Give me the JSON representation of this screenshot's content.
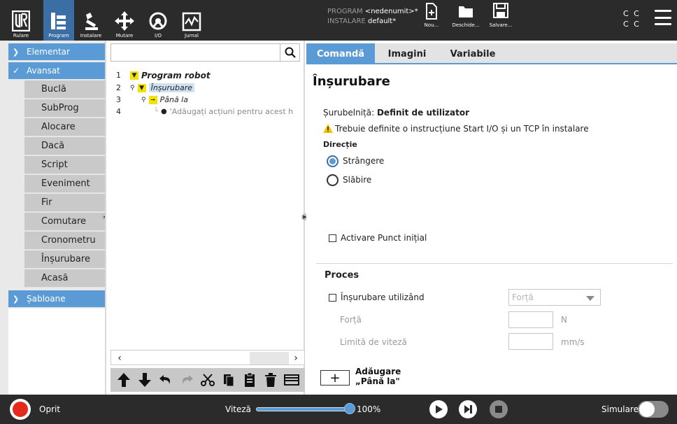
{
  "header": {
    "nav": [
      {
        "label": "Rulare",
        "icon": "ur-logo-icon"
      },
      {
        "label": "Program",
        "icon": "program-tree-icon",
        "active": true
      },
      {
        "label": "Instalare",
        "icon": "robot-arm-icon"
      },
      {
        "label": "Mutare",
        "icon": "move-arrows-icon"
      },
      {
        "label": "I/O",
        "icon": "io-gauge-icon"
      },
      {
        "label": "Jurnal",
        "icon": "log-chart-icon"
      }
    ],
    "program_key": "PROGRAM",
    "program_value": "<nedenumit>*",
    "install_key": "INSTALARE",
    "install_value": "default*",
    "file_buttons": [
      {
        "label": "Nou...",
        "icon": "new-file-icon"
      },
      {
        "label": "Deschide...",
        "icon": "folder-icon"
      },
      {
        "label": "Salvare...",
        "icon": "save-icon"
      }
    ],
    "cc_line1": "C C",
    "cc_line2": "C C"
  },
  "sidebar": {
    "sections": [
      {
        "label": "Elementar",
        "expanded": false
      },
      {
        "label": "Avansat",
        "expanded": true
      },
      {
        "label": "Șabloane",
        "expanded": false
      }
    ],
    "items": [
      "Buclă",
      "SubProg",
      "Alocare",
      "Dacă",
      "Script",
      "Eveniment",
      "Fir",
      "Comutare",
      "Cronometru",
      "Înșurubare",
      "Acasă"
    ]
  },
  "tree": {
    "search_placeholder": "",
    "rows": [
      {
        "num": "1",
        "text": "Program robot"
      },
      {
        "num": "2",
        "text": "Înșurubare"
      },
      {
        "num": "3",
        "text": "Până la"
      },
      {
        "num": "4",
        "text": "'Adăugați acțiuni pentru acest h"
      }
    ],
    "scroll_left": "‹",
    "scroll_right": "›"
  },
  "content": {
    "tabs": [
      "Comandă",
      "Imagini",
      "Variabile"
    ],
    "title": "Înșurubare",
    "tool_label": "Șurubelniță:",
    "tool_value": "Definit de utilizator",
    "warning": "Trebuie definite o instrucțiune Start I/O și un TCP în instalare",
    "direction_label": "Direcție",
    "direction_options": [
      "Strângere",
      "Slăbire"
    ],
    "direction_selected": "Strângere",
    "start_point_label": "Activare Punct inițial",
    "process_heading": "Proces",
    "screw_using_label": "Înșurubare utilizând",
    "screw_using_value": "Forță",
    "force_label": "Forță",
    "force_unit": "N",
    "speed_limit_label": "Limită de viteză",
    "speed_limit_unit": "mm/s",
    "add_label_line1": "Adăugare",
    "add_label_line2": "„Până la\""
  },
  "bottom": {
    "status": "Oprit",
    "speed_label": "Viteză",
    "speed_value": "100%",
    "speed_fraction": 1.0,
    "sim_label": "Simulare"
  },
  "colors": {
    "accent": "#5b9bd5",
    "header_bg": "#2b2b2b",
    "stop_red": "#e32a1c",
    "tree_yellow": "#f2e400"
  }
}
